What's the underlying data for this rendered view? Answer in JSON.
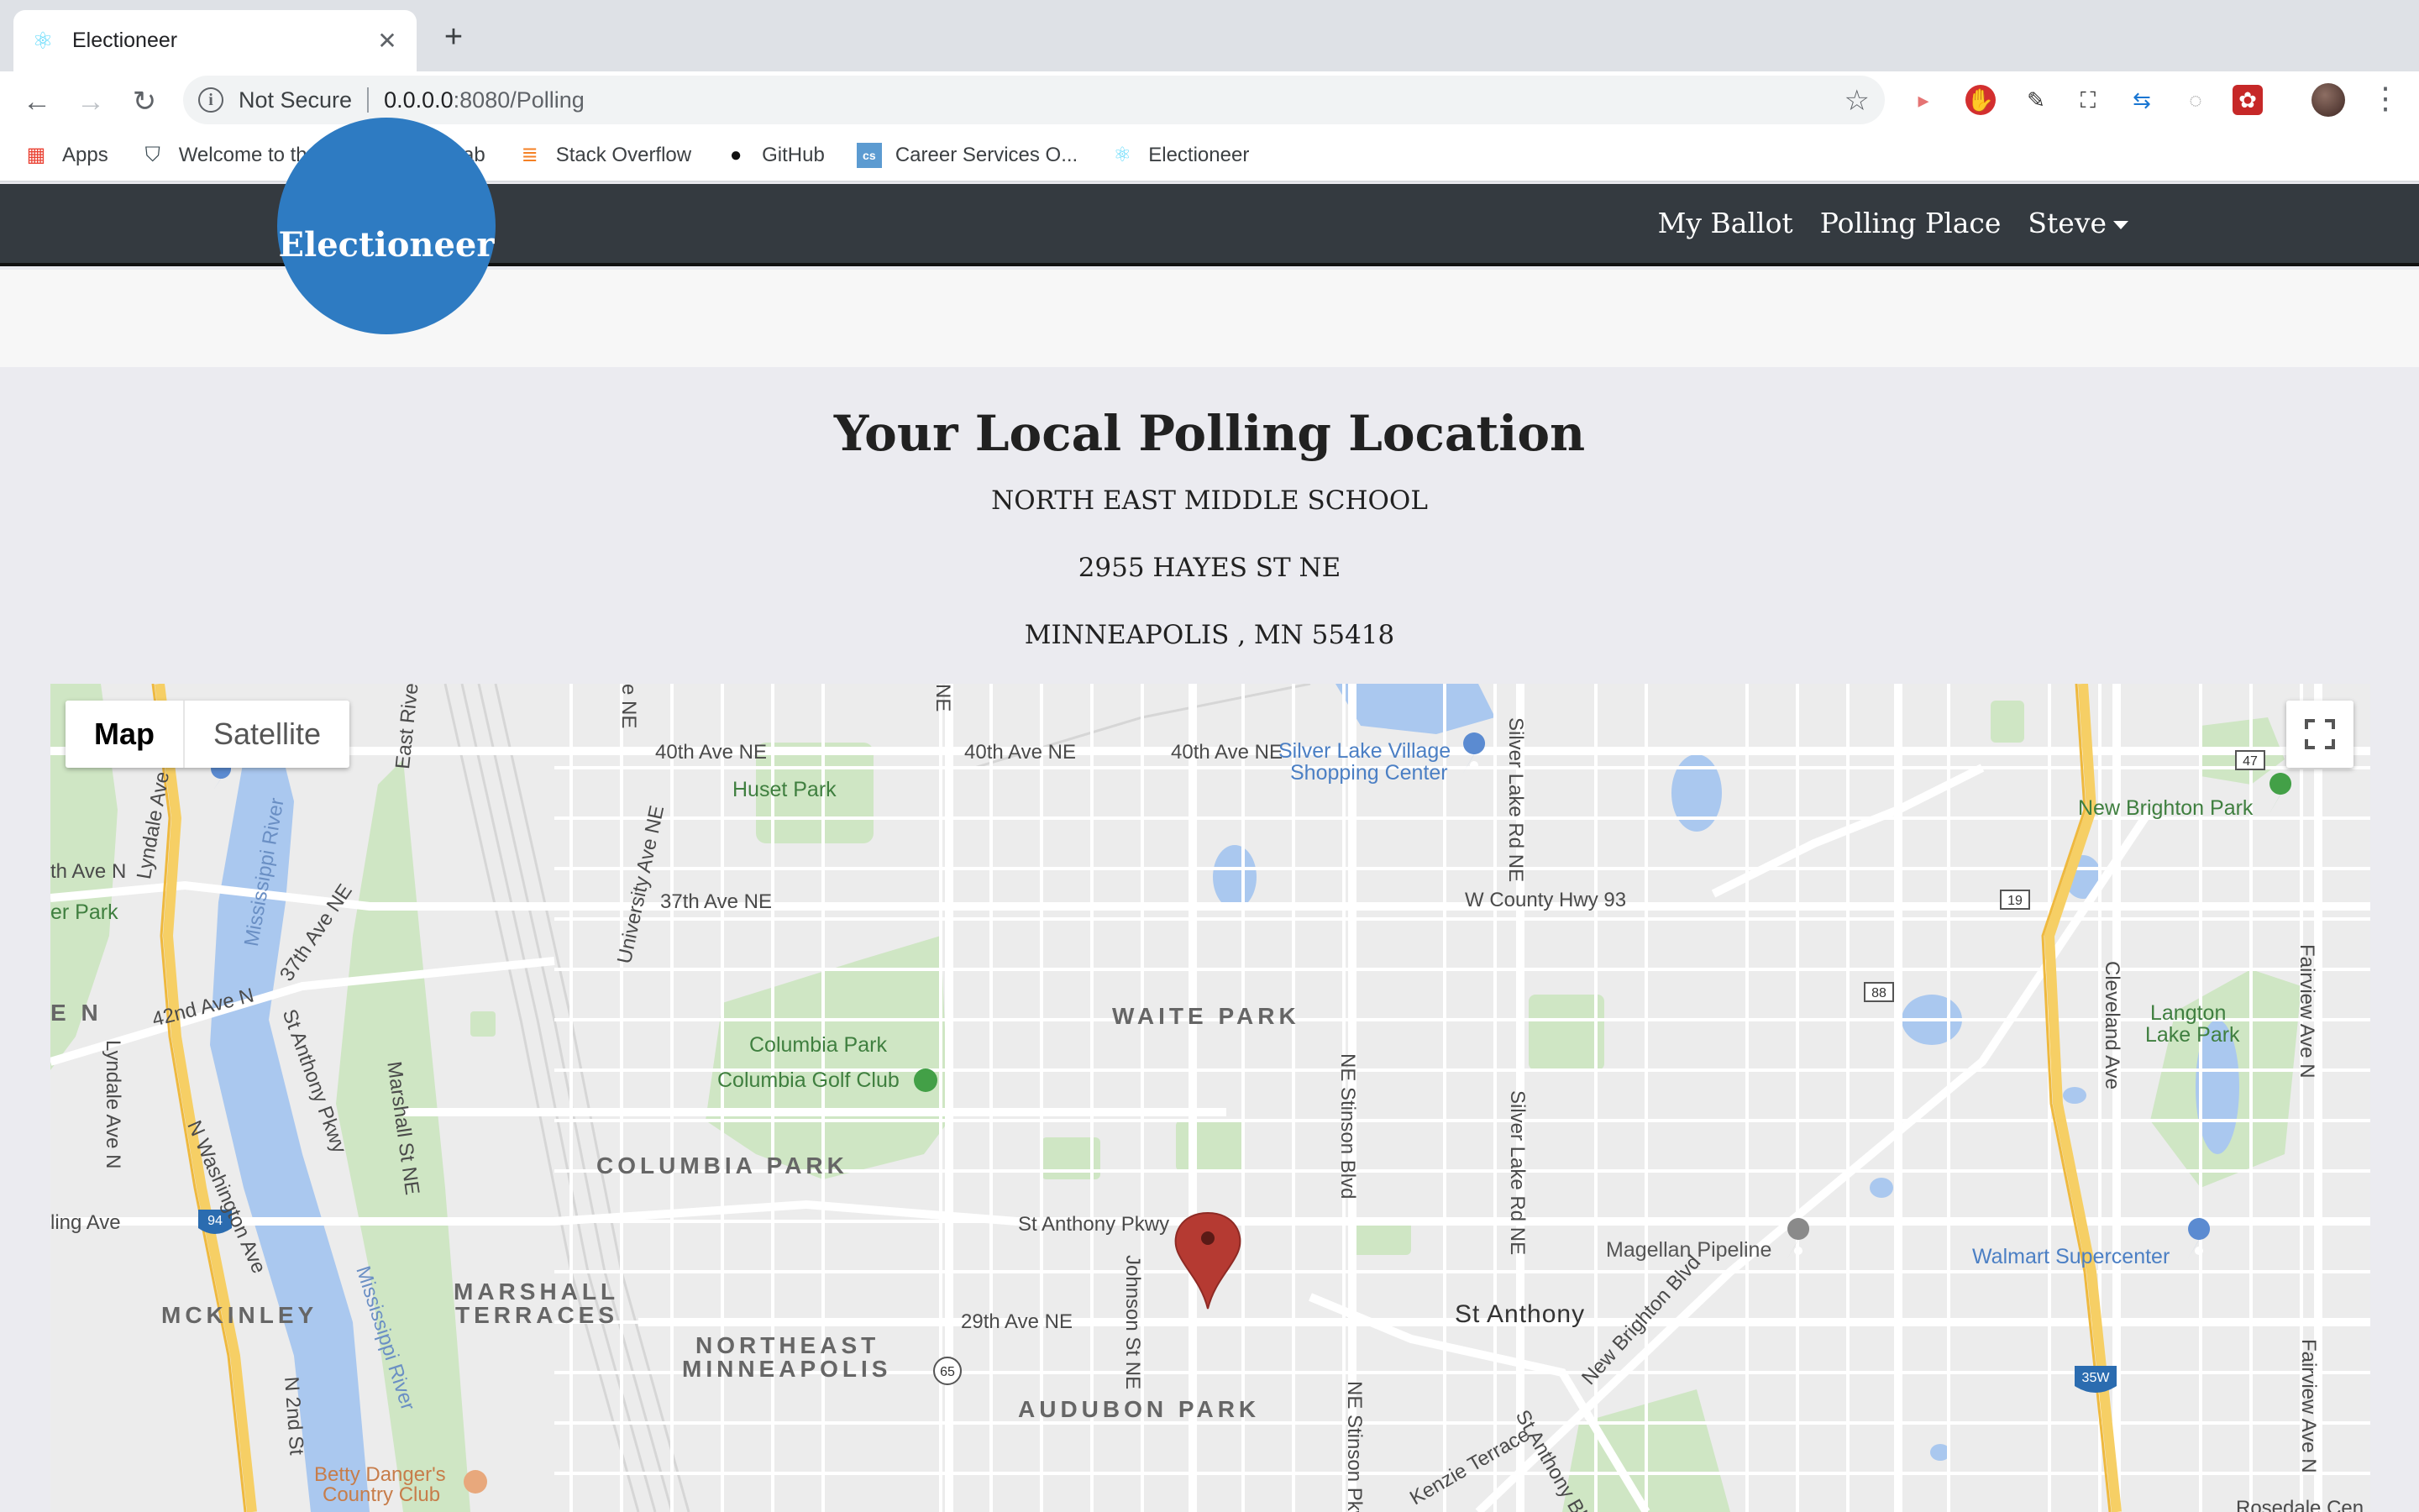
{
  "browser": {
    "tab_title": "Electioneer",
    "new_tab": "+",
    "security_label": "Not Secure",
    "url_host": "0.0.0.0",
    "url_path": ":8080/Polling",
    "bookmarks": [
      "Apps",
      "Welcome to the N...",
      "GitLab",
      "Stack Overflow",
      "GitHub",
      "Career Services O...",
      "Electioneer"
    ]
  },
  "site": {
    "brand": "Electioneer",
    "nav": {
      "ballot": "My Ballot",
      "polling": "Polling Place",
      "user": "Steve"
    }
  },
  "page": {
    "title": "Your Local Polling Location",
    "location_name": "NORTH EAST MIDDLE SCHOOL",
    "street": "2955 HAYES ST NE",
    "city_line": "MINNEAPOLIS , MN 55418"
  },
  "map": {
    "type_map": "Map",
    "type_satellite": "Satellite",
    "labels": {
      "ave40_a": "40th Ave NE",
      "ave40_b": "40th Ave NE",
      "ave40_c": "40th Ave NE",
      "silver_lake_1": "Silver Lake Village",
      "silver_lake_2": "Shopping Center",
      "huset": "Huset Park",
      "ave37": "37th Ave NE",
      "county93": "W County Hwy 93",
      "new_brighton": "New Brighton Park",
      "th_ave_n": "th Ave N",
      "er_park": "er Park",
      "waite": "WAITE PARK",
      "columbia_park": "Columbia Park",
      "columbia_golf": "Columbia Golf Club",
      "columbia_hood": "COLUMBIA PARK",
      "langton_1": "Langton",
      "langton_2": "Lake Park",
      "ave42": "42nd Ave N",
      "st_anthony_pkwy": "St Anthony Pkwy",
      "magellan": "Magellan Pipeline",
      "walmart": "Walmart Supercenter",
      "ling_ave": "ling Ave",
      "marshall_1": "MARSHALL",
      "marshall_2": "TERRACES",
      "mckinley": "MCKINLEY",
      "st_anthony": "St Anthony",
      "ave29": "29th Ave NE",
      "ne_mpls_1": "NORTHEAST",
      "ne_mpls_2": "MINNEAPOLIS",
      "audubon": "AUDUBON PARK",
      "betty_1": "Betty Danger's",
      "betty_2": "Country Club",
      "rosedale": "Rosedale Cen",
      "e_n": "E N",
      "univ_ave": "University Ave NE",
      "marshall_st": "Marshall St NE",
      "johnson": "Johnson St NE",
      "stinson": "NE Stinson Blvd",
      "stinson_pkwy": "NE Stinson Pkwy",
      "silver_lake_rd": "Silver Lake Rd NE",
      "silver_lake_rd2": "Silver Lake Rd NE",
      "lyndale": "Lyndale Ave N",
      "lyndale2": "Lyndale Ave N",
      "washington": "N Washington Ave",
      "st_anthony_pkwy2": "St Anthony Pkwy",
      "ave37_n": "37th Ave NE",
      "mississippi": "Mississippi River",
      "mississippi2": "Mississippi River",
      "cleveland": "Cleveland Ave",
      "fairview": "Fairview Ave N",
      "fairview2": "Fairview Ave N",
      "new_brighton_blvd": "New Brighton Blvd",
      "kenzie": "Kenzie Terrace",
      "st_anthony_blvd": "St Anthony Blvd",
      "second_st": "N 2nd St",
      "east_river": "East River R",
      "e_ne": "e NE",
      "ne_top": "NE",
      "hwy47": "47",
      "hwy19": "19",
      "hwy88": "88",
      "hwy94": "94",
      "hwy65": "65",
      "hwy35w": "35W"
    }
  },
  "colors": {
    "navbar": "#343a40",
    "brand_circle": "#2e7bc2",
    "marker": "#c0392b",
    "park": "#cfe6c4",
    "water": "#aac8ef",
    "highway": "#f6cf65"
  }
}
